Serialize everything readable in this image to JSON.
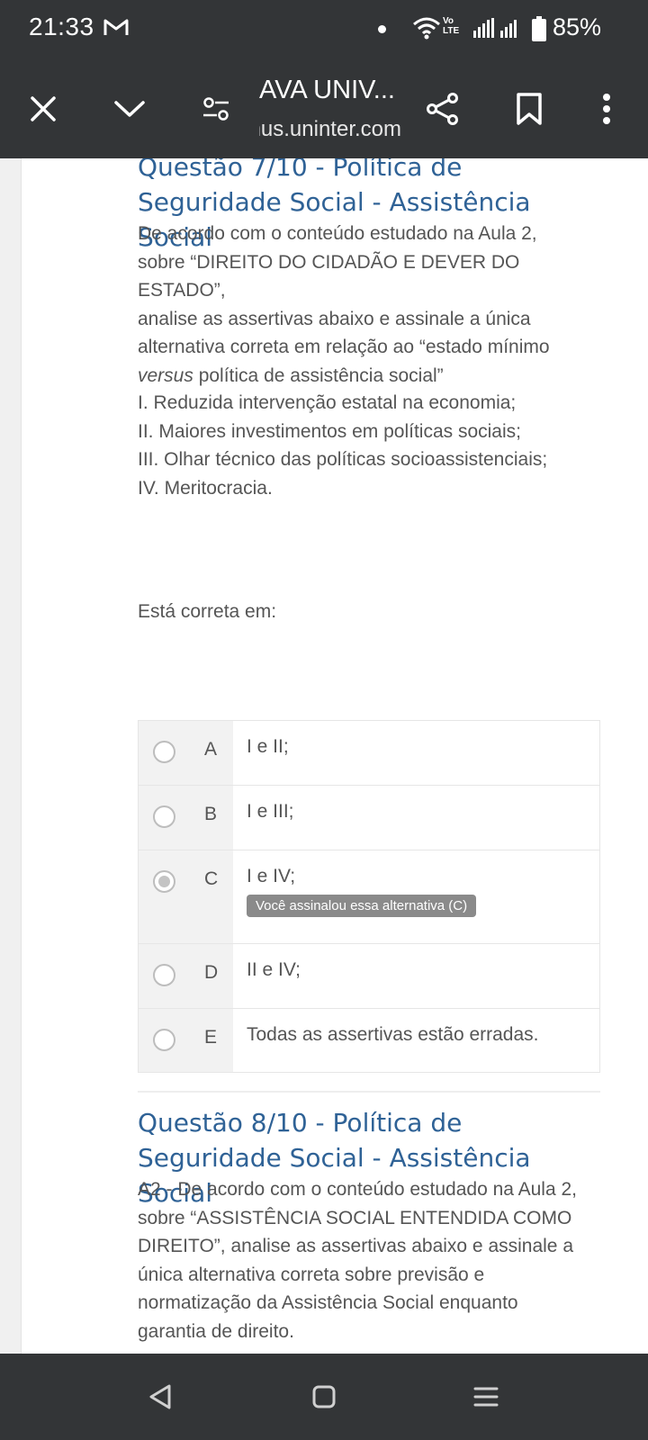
{
  "status_bar": {
    "time": "21:33",
    "battery": "85%",
    "volte_line1": "Vo",
    "volte_line2": "LTE",
    "icons": [
      "gmail-icon",
      "dot-icon",
      "wifi-icon",
      "volte-icon",
      "signal-icon",
      "signal-icon",
      "battery-icon"
    ]
  },
  "toolbar": {
    "title": "AVA UNIV...",
    "url": "nus.uninter.com",
    "icons": [
      "close-icon",
      "chevron-down-icon",
      "tune-icon",
      "share-icon",
      "bookmark-icon",
      "more-vert-icon"
    ]
  },
  "question7": {
    "title": "Questão 7/10 - Política de Seguridade Social - Assistência Social",
    "text_lines": [
      "De acordo com o conteúdo estudado na Aula 2,",
      "sobre “DIREITO DO CIDADÃO E DEVER DO ESTADO”,",
      "analise as assertivas abaixo e assinale a única",
      "alternativa correta em relação ao “estado mínimo"
    ],
    "text_italic": "versus",
    "text_tail": " política de assistência social”",
    "assertions": [
      "I. Reduzida intervenção estatal na economia;",
      "II. Maiores investimentos em políticas sociais;",
      "III. Olhar técnico das políticas socioassistenciais;",
      "IV. Meritocracia."
    ],
    "prompt": "Está correta em:",
    "options": [
      {
        "letter": "A",
        "text": "I e II;",
        "selected": false
      },
      {
        "letter": "B",
        "text": "I e III;",
        "selected": false
      },
      {
        "letter": "C",
        "text": "I e IV;",
        "selected": true
      },
      {
        "letter": "D",
        "text": "II e IV;",
        "selected": false
      },
      {
        "letter": "E",
        "text": "Todas as assertivas estão erradas.",
        "selected": false
      }
    ],
    "selected_badge": "Você assinalou essa alternativa (C)"
  },
  "question8": {
    "title": "Questão 8/10 - Política de Seguridade Social - Assistência Social",
    "text_lines": [
      "A2 - De acordo com o conteúdo estudado na Aula 2,",
      "sobre “ASSISTÊNCIA SOCIAL ENTENDIDA COMO",
      "DIREITO”, analise as assertivas abaixo e assinale a",
      "única alternativa correta sobre previsão e",
      "normatização da Assistência Social enquanto",
      "garantia de direito."
    ]
  },
  "nav_bar": {
    "icons": [
      "back-icon",
      "home-icon",
      "recents-icon"
    ]
  },
  "colors": {
    "bars": "#333537",
    "question_title": "#2f6296",
    "body_text": "#555555"
  }
}
